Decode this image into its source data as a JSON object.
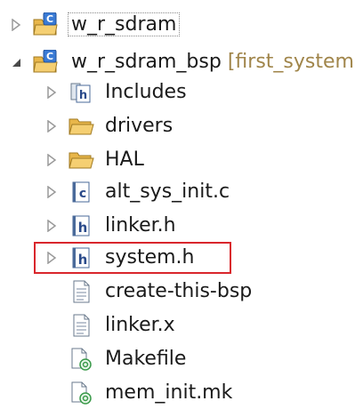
{
  "colors": {
    "highlight": "#d9262c",
    "folder": "#e8b64a",
    "project": "#3a7bd5",
    "decoration": "#a0854a"
  },
  "tree": {
    "project1": {
      "label": "w_r_sdram",
      "state": "collapsed",
      "icon": "c-project-icon"
    },
    "project2": {
      "label": "w_r_sdram_bsp",
      "decoration": "[first_system]",
      "state": "expanded",
      "icon": "c-project-icon"
    },
    "items": [
      {
        "label": "Includes",
        "icon": "includes-icon",
        "twisty": "collapsed"
      },
      {
        "label": "drivers",
        "icon": "folder-icon",
        "twisty": "collapsed"
      },
      {
        "label": "HAL",
        "icon": "folder-icon",
        "twisty": "collapsed"
      },
      {
        "label": "alt_sys_init.c",
        "icon": "c-source-file-icon",
        "twisty": "collapsed"
      },
      {
        "label": "linker.h",
        "icon": "header-file-icon",
        "twisty": "collapsed"
      },
      {
        "label": "system.h",
        "icon": "header-file-icon",
        "twisty": "collapsed"
      },
      {
        "label": "create-this-bsp",
        "icon": "text-file-icon"
      },
      {
        "label": "linker.x",
        "icon": "text-file-icon"
      },
      {
        "label": "Makefile",
        "icon": "makefile-icon"
      },
      {
        "label": "mem_init.mk",
        "icon": "makefile-icon"
      }
    ]
  }
}
